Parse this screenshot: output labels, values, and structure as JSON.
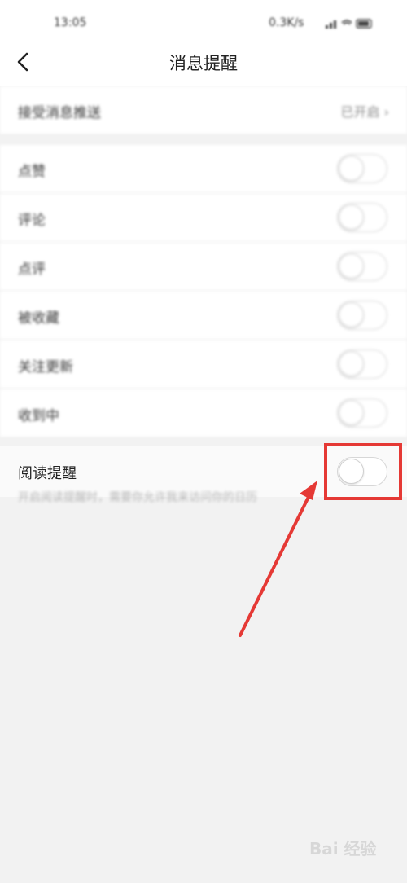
{
  "status_bar": {
    "time": "13:05",
    "network": "0.3K/s",
    "icons": "signal wifi battery"
  },
  "header": {
    "back_icon": "chevron-left-icon",
    "title": "消息提醒"
  },
  "push": {
    "label": "接受消息推送",
    "value": "已开启 ›"
  },
  "notifications": [
    {
      "label": "点赞",
      "enabled": false
    },
    {
      "label": "评论",
      "enabled": false
    },
    {
      "label": "点评",
      "enabled": false
    },
    {
      "label": "被收藏",
      "enabled": false
    },
    {
      "label": "关注更新",
      "enabled": false
    },
    {
      "label": "收到中",
      "enabled": false
    }
  ],
  "read_reminder": {
    "label": "阅读提醒",
    "enabled": false
  },
  "hint": "开启阅读提醒时，需要你允许我来访问你的日历",
  "watermark": "Bai 经验",
  "colors": {
    "background": "#f2f2f2",
    "highlight": "#e53935",
    "toggle_border": "#d7d7d7"
  }
}
